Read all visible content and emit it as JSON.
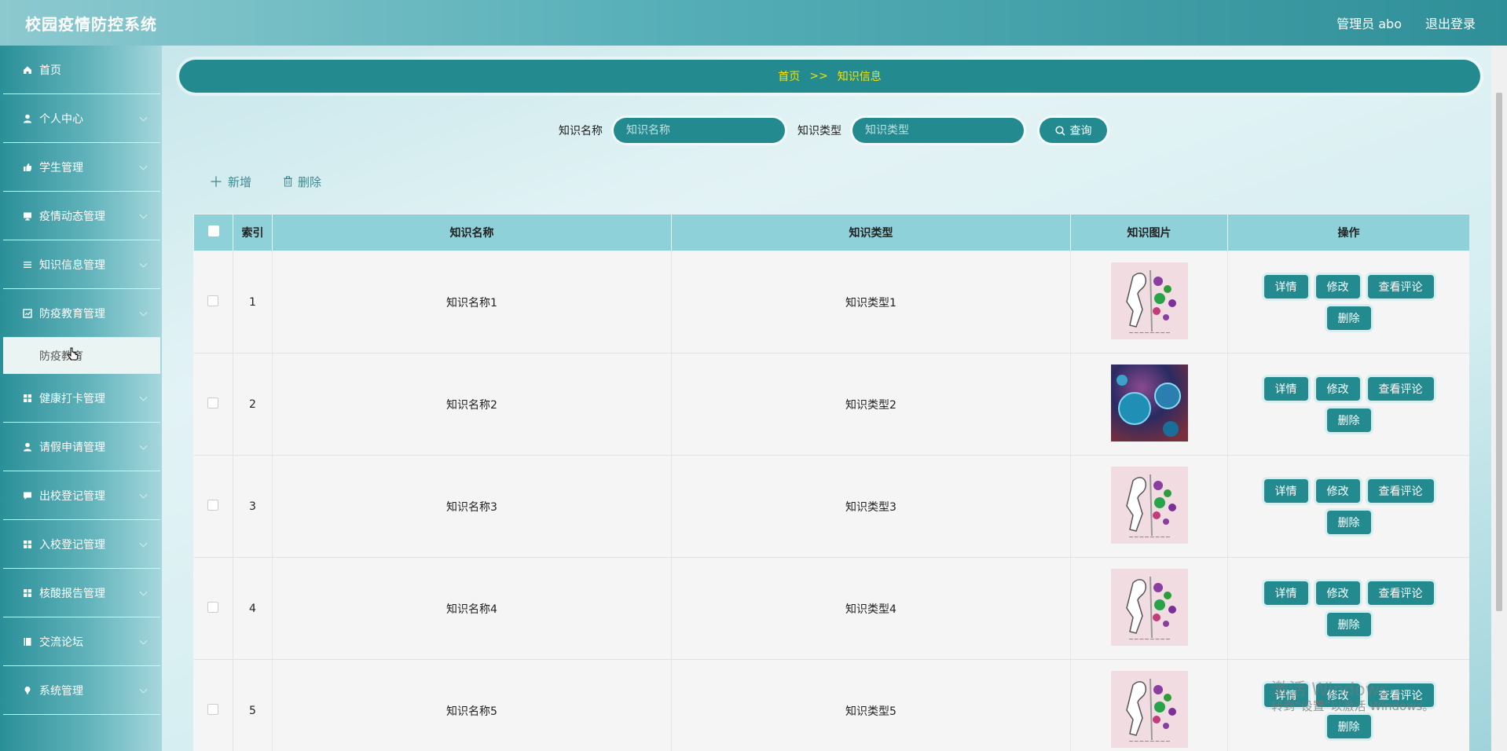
{
  "app": {
    "title": "校园疫情防控系统",
    "user": "管理员 abo",
    "logout": "退出登录"
  },
  "sidebar": {
    "items": [
      {
        "label": "首页",
        "icon": "home-icon"
      },
      {
        "label": "个人中心",
        "icon": "user-icon"
      },
      {
        "label": "学生管理",
        "icon": "thumb-icon"
      },
      {
        "label": "疫情动态管理",
        "icon": "monitor-icon"
      },
      {
        "label": "知识信息管理",
        "icon": "list-icon"
      },
      {
        "label": "防疫教育管理",
        "icon": "chart-icon"
      }
    ],
    "submenu": "防疫教育",
    "items2": [
      {
        "label": "健康打卡管理",
        "icon": "grid-icon"
      },
      {
        "label": "请假申请管理",
        "icon": "user-icon"
      },
      {
        "label": "出校登记管理",
        "icon": "chat-icon"
      },
      {
        "label": "入校登记管理",
        "icon": "grid-icon"
      },
      {
        "label": "核酸报告管理",
        "icon": "grid-icon"
      },
      {
        "label": "交流论坛",
        "icon": "book-icon"
      },
      {
        "label": "系统管理",
        "icon": "pin-icon"
      }
    ]
  },
  "breadcrumb": {
    "home": "首页",
    "sep": ">>",
    "current": "知识信息"
  },
  "search": {
    "name_label": "知识名称",
    "name_placeholder": "知识名称",
    "type_label": "知识类型",
    "type_placeholder": "知识类型",
    "button": "查询"
  },
  "toolbar": {
    "add": "新增",
    "delete": "删除"
  },
  "table": {
    "headers": [
      "索引",
      "知识名称",
      "知识类型",
      "知识图片",
      "操作"
    ],
    "rows": [
      {
        "index": "1",
        "name": "知识名称1",
        "type": "知识类型1",
        "image": "doc"
      },
      {
        "index": "2",
        "name": "知识名称2",
        "type": "知识类型2",
        "image": "virus"
      },
      {
        "index": "3",
        "name": "知识名称3",
        "type": "知识类型3",
        "image": "doc"
      },
      {
        "index": "4",
        "name": "知识名称4",
        "type": "知识类型4",
        "image": "doc"
      },
      {
        "index": "5",
        "name": "知识名称5",
        "type": "知识类型5",
        "image": "doc"
      }
    ],
    "ops": {
      "detail": "详情",
      "edit": "修改",
      "comments": "查看评论",
      "delete": "删除"
    }
  },
  "watermark": {
    "line1": "激活 Windows",
    "line2": "转到“设置”以激活 Windows。"
  }
}
